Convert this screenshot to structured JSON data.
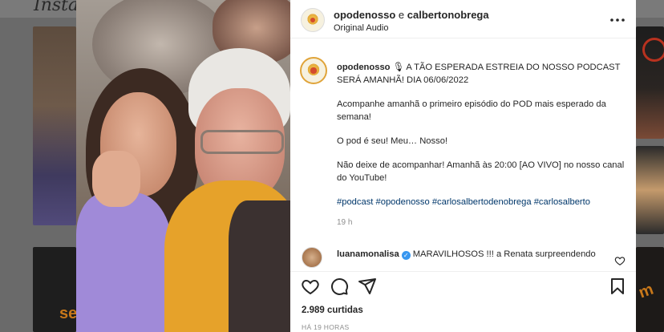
{
  "background": {
    "logo": "Instag",
    "thumb_text_left": "se",
    "thumb_text_right": "m"
  },
  "post": {
    "header": {
      "user_primary": "opodenosso",
      "separator": " e ",
      "user_secondary": "calbertonobrega",
      "audio": "Original Audio"
    },
    "caption": {
      "username": "opodenosso",
      "mic_emoji": "🎙",
      "headline": "A TÃO ESPERADA ESTREIA DO NOSSO PODCAST SERÁ AMANHÃ! DIA 06/06/2022",
      "p1": "Acompanhe amanhã o primeiro episódio do POD mais esperado da semana!",
      "p2": "O pod é seu! Meu… Nosso!",
      "p3": "Não deixe de acompanhar! Amanhã às 20:00 [AO VIVO] no nosso canal do YouTube!",
      "hashtags": [
        "#podcast",
        "#opodenosso",
        "#carlosalbertodenobrega",
        "#carlosalberto"
      ],
      "time": "19 h"
    },
    "comment": {
      "username": "luanamonalisa",
      "verified_mark": "✓",
      "text": "MARAVILHOSOS !!! a Renata surpreendendo"
    },
    "likes": "2.989 curtidas",
    "ago": "HÁ 19 HORAS"
  },
  "colors": {
    "link": "#00376b",
    "verified": "#3897f0",
    "text": "#262626",
    "muted": "#8e8e8e"
  },
  "icons": [
    "more-icon",
    "heart-icon",
    "comment-icon",
    "share-icon",
    "bookmark-icon"
  ]
}
